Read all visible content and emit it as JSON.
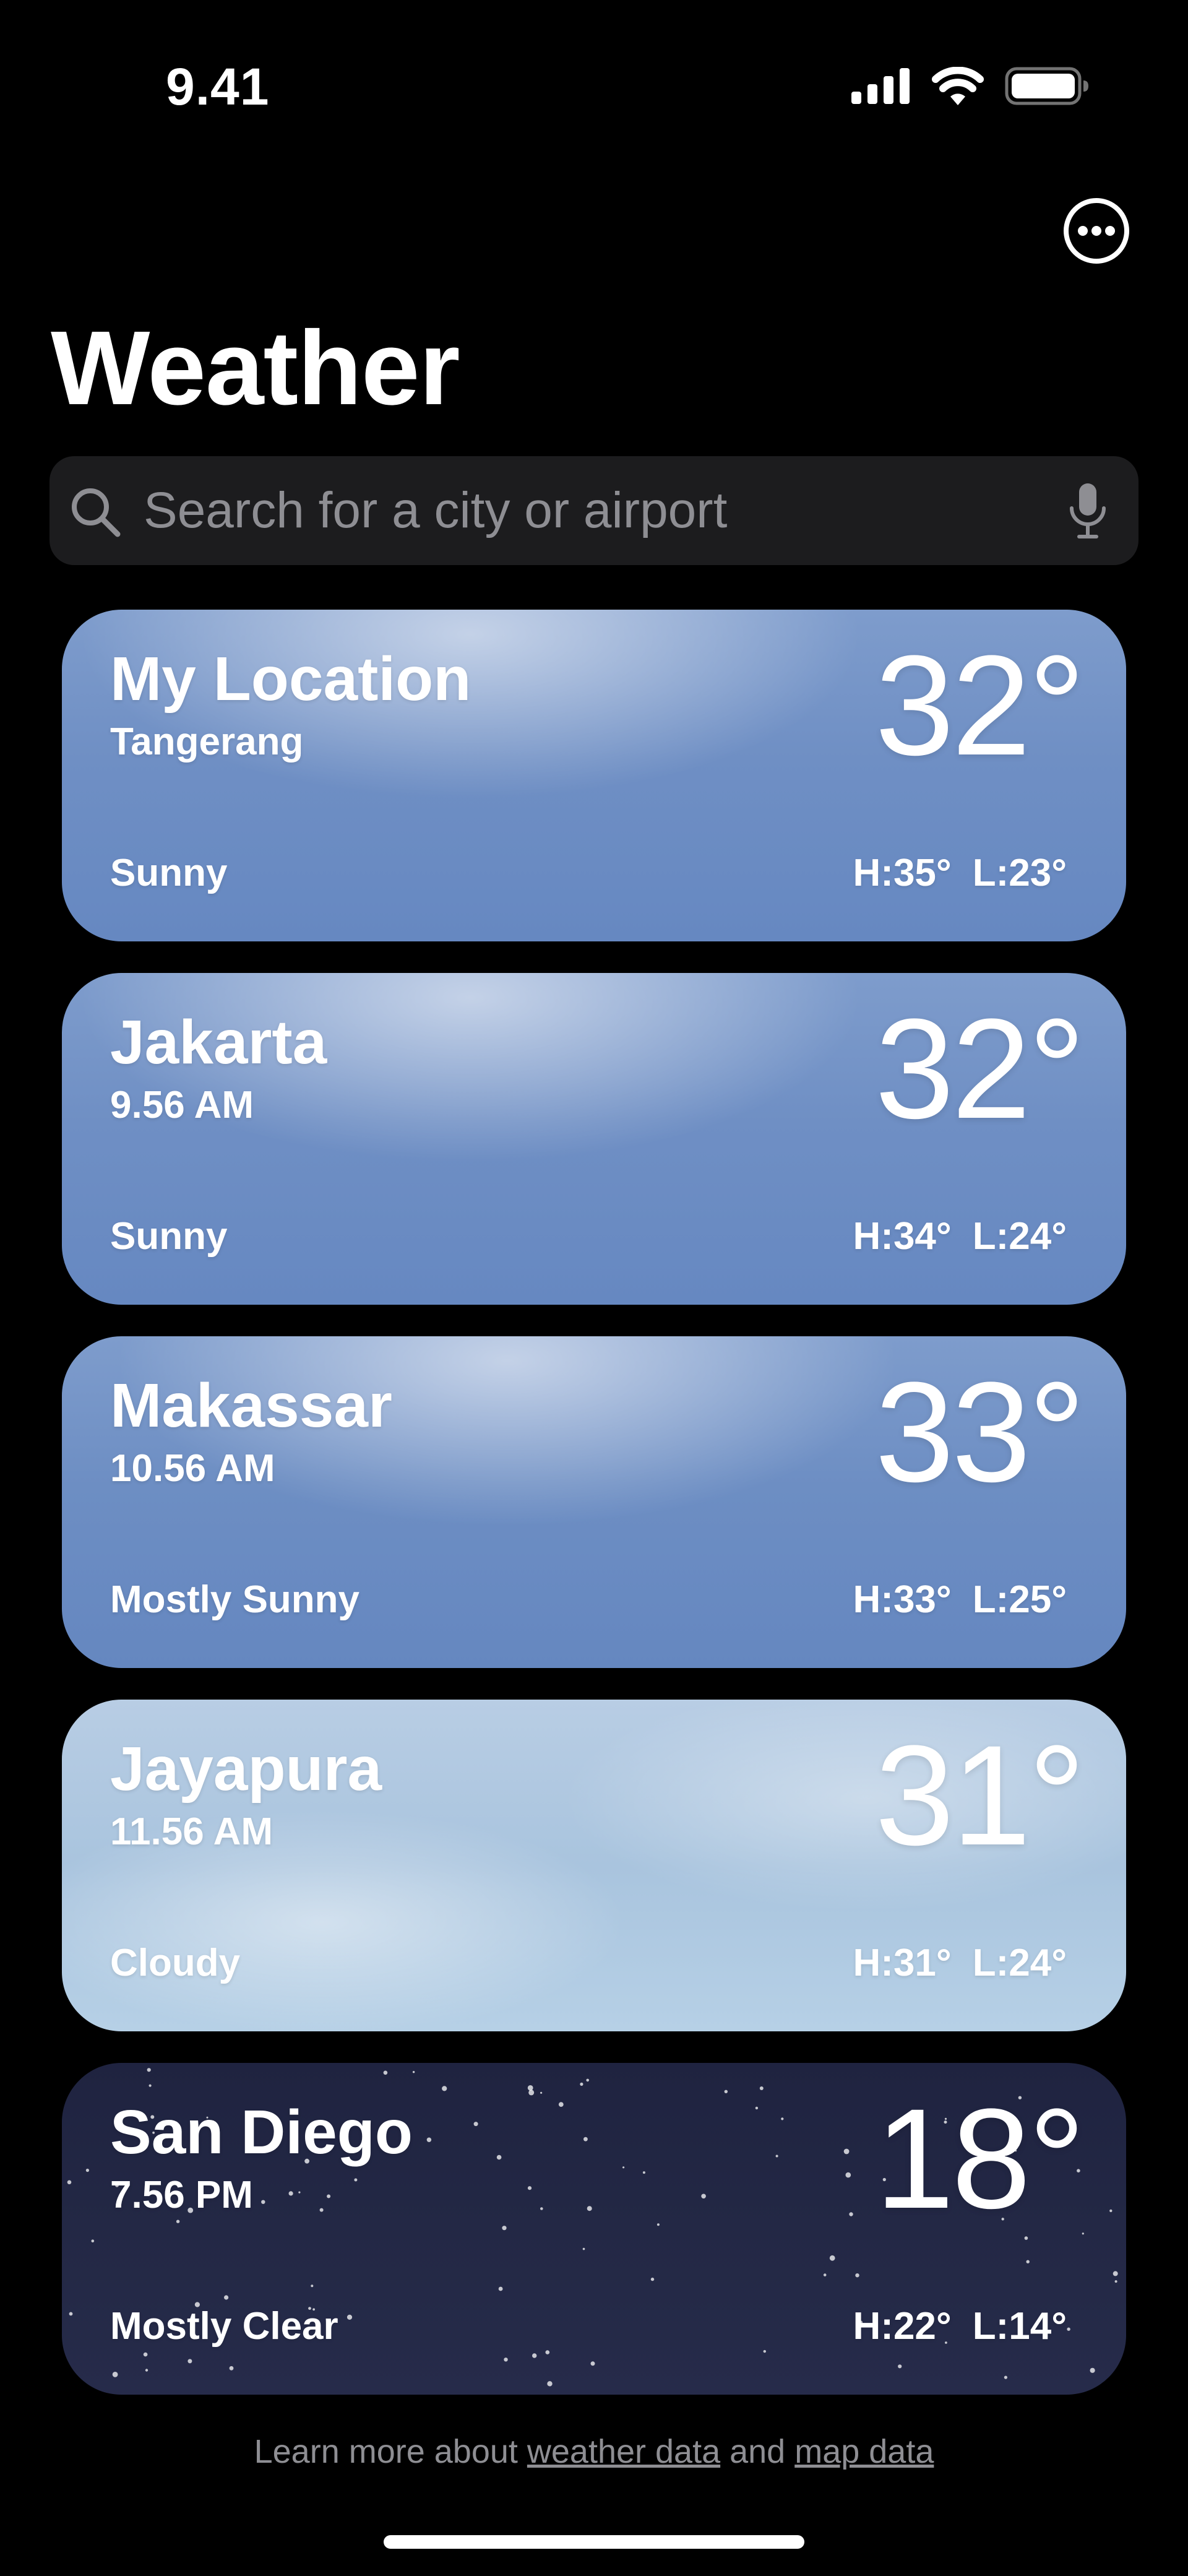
{
  "status_bar": {
    "time": "9.41"
  },
  "header": {
    "title": "Weather",
    "more_icon": "ellipsis-circle-icon"
  },
  "search": {
    "placeholder": "Search for a city or airport",
    "value": "",
    "icon": "search-icon",
    "mic_icon": "microphone-icon"
  },
  "locations": [
    {
      "city": "My Location",
      "subtitle": "Tangerang",
      "temperature": "32°",
      "condition": "Sunny",
      "high": "H:35°",
      "low": "L:23°",
      "theme": "sunny"
    },
    {
      "city": "Jakarta",
      "subtitle": "9.56 AM",
      "temperature": "32°",
      "condition": "Sunny",
      "high": "H:34°",
      "low": "L:24°",
      "theme": "sunny"
    },
    {
      "city": "Makassar",
      "subtitle": "10.56 AM",
      "temperature": "33°",
      "condition": "Mostly Sunny",
      "high": "H:33°",
      "low": "L:25°",
      "theme": "mostly-sunny"
    },
    {
      "city": "Jayapura",
      "subtitle": "11.56 AM",
      "temperature": "31°",
      "condition": "Cloudy",
      "high": "H:31°",
      "low": "L:24°",
      "theme": "cloudy"
    },
    {
      "city": "San Diego",
      "subtitle": "7.56 PM",
      "temperature": "18°",
      "condition": "Mostly Clear",
      "high": "H:22°",
      "low": "L:14°",
      "theme": "clear-night"
    }
  ],
  "footer": {
    "prefix": "Learn more about ",
    "weather_data_link": "weather data",
    "middle": " and ",
    "map_data_link": "map data"
  },
  "colors": {
    "background": "#000000",
    "search_bg": "#1c1c1e",
    "placeholder": "#8e8e93",
    "sunny_card": "#6f8fc4",
    "cloudy_card": "#a9c4de",
    "night_card": "#232845"
  }
}
